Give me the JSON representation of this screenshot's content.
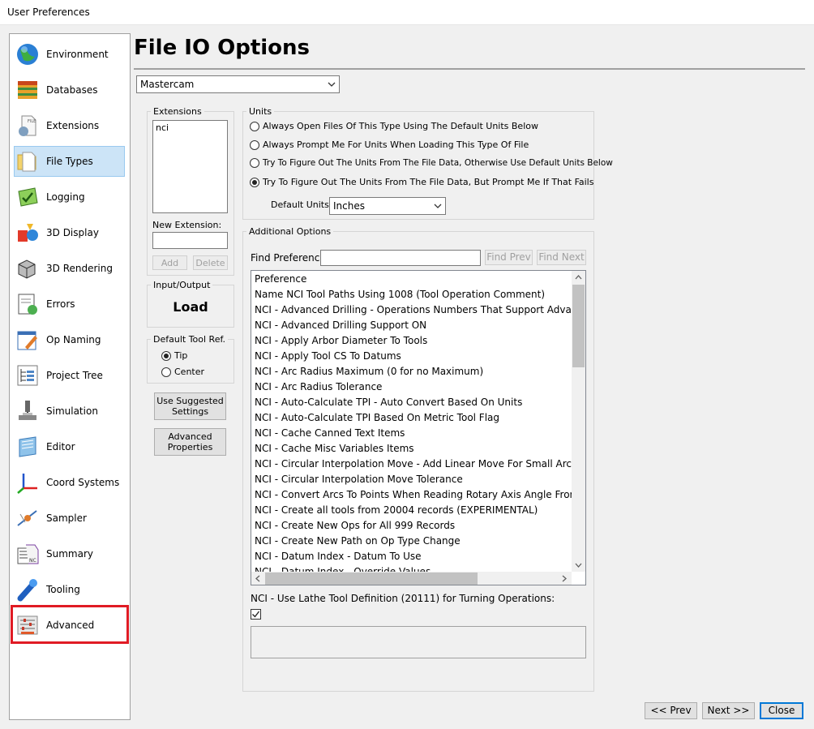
{
  "window": {
    "title": "User Preferences"
  },
  "sidebar": {
    "items": [
      {
        "label": "Environment",
        "icon": "globe-icon"
      },
      {
        "label": "Databases",
        "icon": "database-icon"
      },
      {
        "label": "Extensions",
        "icon": "file-extension-icon"
      },
      {
        "label": "File Types",
        "icon": "folder-file-icon"
      },
      {
        "label": "Logging",
        "icon": "logging-icon"
      },
      {
        "label": "3D Display",
        "icon": "3d-display-icon"
      },
      {
        "label": "3D Rendering",
        "icon": "3d-rendering-icon"
      },
      {
        "label": "Errors",
        "icon": "errors-icon"
      },
      {
        "label": "Op Naming",
        "icon": "op-naming-icon"
      },
      {
        "label": "Project Tree",
        "icon": "project-tree-icon"
      },
      {
        "label": "Simulation",
        "icon": "simulation-icon"
      },
      {
        "label": "Editor",
        "icon": "editor-icon"
      },
      {
        "label": "Coord Systems",
        "icon": "coord-systems-icon"
      },
      {
        "label": "Sampler",
        "icon": "sampler-icon"
      },
      {
        "label": "Summary",
        "icon": "summary-icon"
      },
      {
        "label": "Tooling",
        "icon": "tooling-icon"
      },
      {
        "label": "Advanced",
        "icon": "advanced-icon"
      }
    ],
    "selected": "File Types"
  },
  "main": {
    "title": "File IO Options",
    "file_type": {
      "value": "Mastercam"
    },
    "extensions": {
      "label": "Extensions",
      "items": [
        "nci"
      ],
      "new_label": "New Extension:",
      "new_value": "",
      "add": "Add",
      "delete": "Delete"
    },
    "io": {
      "label": "Input/Output",
      "value": "Load"
    },
    "tool_ref": {
      "label": "Default Tool Ref.",
      "options": [
        "Tip",
        "Center"
      ],
      "selected": "Tip"
    },
    "use_suggested": "Use Suggested Settings",
    "advanced_props": "Advanced Properties",
    "units": {
      "label": "Units",
      "options": [
        "Always Open Files Of This Type Using The Default Units Below",
        "Always Prompt Me For Units When Loading This Type Of File",
        "Try To Figure Out The Units From The File Data, Otherwise Use Default Units Below",
        "Try To Figure Out The Units From The File Data, But Prompt Me If That Fails"
      ],
      "selected_index": 3,
      "default_label": "Default Units:",
      "default_value": "Inches"
    },
    "additional": {
      "label": "Additional Options",
      "find_label": "Find Preference",
      "find_value": "",
      "find_prev": "Find Prev",
      "find_next": "Find Next",
      "column": "Preference",
      "rows": [
        "Name NCI Tool Paths Using 1008 (Tool Operation Comment)",
        "NCI - Advanced Drilling - Operations Numbers That Support Advanced Drilling",
        "NCI - Advanced Drilling Support ON",
        "NCI - Apply Arbor Diameter To Tools",
        "NCI - Apply Tool CS To Datums",
        "NCI - Arc Radius Maximum (0 for no Maximum)",
        "NCI - Arc Radius Tolerance",
        "NCI - Auto-Calculate TPI - Auto Convert Based On Units",
        "NCI - Auto-Calculate TPI Based On Metric Tool Flag",
        "NCI - Cache Canned Text Items",
        "NCI - Cache Misc Variables Items",
        "NCI - Circular Interpolation Move - Add Linear Move For Small Arcs",
        "NCI - Circular Interpolation Move Tolerance",
        "NCI - Convert Arcs To Points When Reading Rotary Axis Angle From Tool Vector",
        "NCI - Create all tools from 20004 records (EXPERIMENTAL)",
        "NCI - Create New Ops for All 999 Records",
        "NCI - Create New Path on Op Type Change",
        "NCI - Datum Index - Datum To Use",
        "NCI - Datum Index - Override Values"
      ],
      "selected_pref": "NCI - Use Lathe Tool Definition (20111) for Turning Operations:",
      "selected_checked": true,
      "description": ""
    }
  },
  "footer": {
    "prev": "<< Prev",
    "next": "Next >>",
    "close": "Close"
  }
}
